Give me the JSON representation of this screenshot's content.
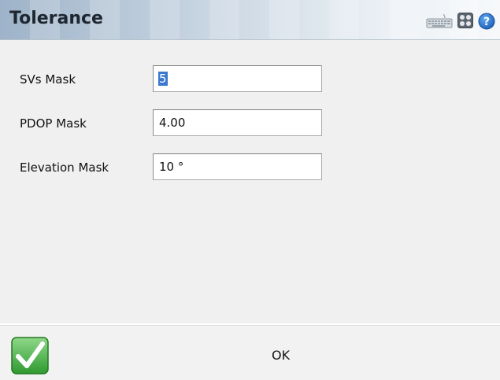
{
  "window": {
    "title": "Tolerance"
  },
  "toolbar_icons": [
    "keyboard-icon",
    "apps-icon",
    "help-icon"
  ],
  "form": {
    "fields": [
      {
        "label": "SVs Mask",
        "value": "5",
        "selected": true
      },
      {
        "label": "PDOP Mask",
        "value": "4.00",
        "selected": false
      },
      {
        "label": "Elevation Mask",
        "value": "10 °",
        "selected": false
      }
    ]
  },
  "footer": {
    "ok_label": "OK"
  },
  "colors": {
    "accent_check": "#3cab3c",
    "selection": "#3c78d0",
    "help": "#1f6fd0"
  }
}
